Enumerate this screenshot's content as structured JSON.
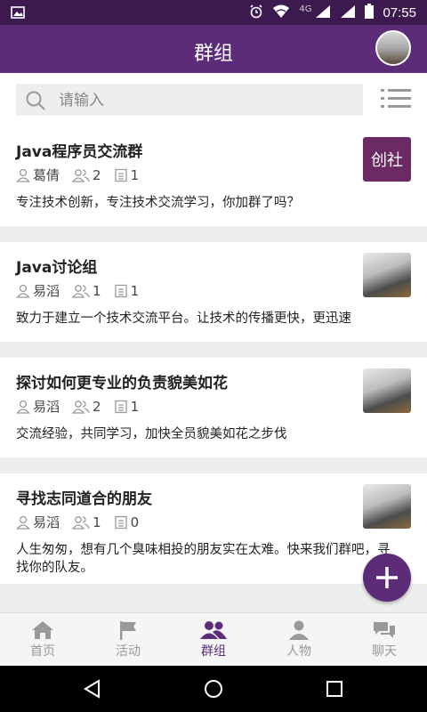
{
  "status_bar": {
    "time": "07:55",
    "network": "4G"
  },
  "app_bar": {
    "title": "群组"
  },
  "search": {
    "placeholder": "请输入"
  },
  "groups": [
    {
      "name": "Java程序员交流群",
      "owner": "葛倩",
      "members": "2",
      "posts": "1",
      "description": "专注技术创新，专注技术交流学习，你加群了吗？",
      "thumb_text": "创社"
    },
    {
      "name": "Java讨论组",
      "owner": "易滔",
      "members": "1",
      "posts": "1",
      "description": "致力于建立一个技术交流平台。让技术的传播更快，更迅速"
    },
    {
      "name": "探讨如何更专业的负责貌美如花",
      "owner": "易滔",
      "members": "2",
      "posts": "1",
      "description": "交流经验，共同学习，加快全员貌美如花之步伐"
    },
    {
      "name": "寻找志同道合的朋友",
      "owner": "易滔",
      "members": "1",
      "posts": "0",
      "description": "人生匆匆，想有几个臭味相投的朋友实在太难。快来我们群吧，寻找你的队友。"
    }
  ],
  "bottom_nav": [
    {
      "label": "首页",
      "icon": "home-icon"
    },
    {
      "label": "活动",
      "icon": "flag-icon"
    },
    {
      "label": "群组",
      "icon": "group-icon",
      "active": true
    },
    {
      "label": "人物",
      "icon": "person-icon"
    },
    {
      "label": "聊天",
      "icon": "chat-icon"
    }
  ],
  "colors": {
    "primary": "#5c2c78",
    "status_bar": "#3c1a4f",
    "inactive": "#999999"
  }
}
